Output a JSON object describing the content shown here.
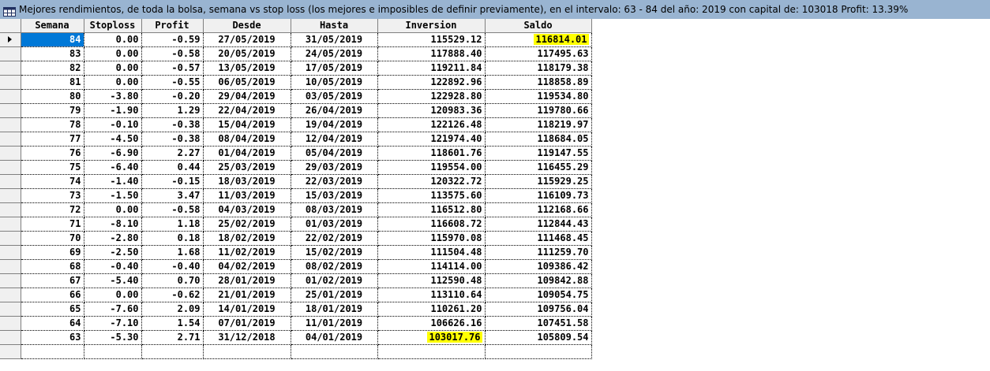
{
  "window": {
    "title": "Mejores rendimientos, de toda la bolsa, semana vs stop loss (los mejores e imposibles de definir previamente), en el intervalo: 63 - 84 del año: 2019 con capital de: 103018 Profit: 13.39%"
  },
  "table": {
    "columns": [
      "Semana",
      "Stoploss",
      "Profit",
      "Desde",
      "Hasta",
      "Inversion",
      "Saldo"
    ],
    "rows": [
      [
        "84",
        "0.00",
        "-0.59",
        "27/05/2019",
        "31/05/2019",
        "115529.12",
        "116814.01"
      ],
      [
        "83",
        "0.00",
        "-0.58",
        "20/05/2019",
        "24/05/2019",
        "117888.40",
        "117495.63"
      ],
      [
        "82",
        "0.00",
        "-0.57",
        "13/05/2019",
        "17/05/2019",
        "119211.84",
        "118179.38"
      ],
      [
        "81",
        "0.00",
        "-0.55",
        "06/05/2019",
        "10/05/2019",
        "122892.96",
        "118858.89"
      ],
      [
        "80",
        "-3.80",
        "-0.20",
        "29/04/2019",
        "03/05/2019",
        "122928.80",
        "119534.80"
      ],
      [
        "79",
        "-1.90",
        "1.29",
        "22/04/2019",
        "26/04/2019",
        "120983.36",
        "119780.66"
      ],
      [
        "78",
        "-0.10",
        "-0.38",
        "15/04/2019",
        "19/04/2019",
        "122126.48",
        "118219.97"
      ],
      [
        "77",
        "-4.50",
        "-0.38",
        "08/04/2019",
        "12/04/2019",
        "121974.40",
        "118684.05"
      ],
      [
        "76",
        "-6.90",
        "2.27",
        "01/04/2019",
        "05/04/2019",
        "118601.76",
        "119147.55"
      ],
      [
        "75",
        "-6.40",
        "0.44",
        "25/03/2019",
        "29/03/2019",
        "119554.00",
        "116455.29"
      ],
      [
        "74",
        "-1.40",
        "-0.15",
        "18/03/2019",
        "22/03/2019",
        "120322.72",
        "115929.25"
      ],
      [
        "73",
        "-1.50",
        "3.47",
        "11/03/2019",
        "15/03/2019",
        "113575.60",
        "116109.73"
      ],
      [
        "72",
        "0.00",
        "-0.58",
        "04/03/2019",
        "08/03/2019",
        "116512.80",
        "112168.66"
      ],
      [
        "71",
        "-8.10",
        "1.18",
        "25/02/2019",
        "01/03/2019",
        "116608.72",
        "112844.43"
      ],
      [
        "70",
        "-2.80",
        "0.18",
        "18/02/2019",
        "22/02/2019",
        "115970.08",
        "111468.45"
      ],
      [
        "69",
        "-2.50",
        "1.68",
        "11/02/2019",
        "15/02/2019",
        "111504.48",
        "111259.70"
      ],
      [
        "68",
        "-0.40",
        "-0.40",
        "04/02/2019",
        "08/02/2019",
        "114114.00",
        "109386.42"
      ],
      [
        "67",
        "-5.40",
        "0.70",
        "28/01/2019",
        "01/02/2019",
        "112590.48",
        "109842.88"
      ],
      [
        "66",
        "0.00",
        "-0.62",
        "21/01/2019",
        "25/01/2019",
        "113110.64",
        "109054.75"
      ],
      [
        "65",
        "-7.60",
        "2.09",
        "14/01/2019",
        "18/01/2019",
        "110261.20",
        "109756.04"
      ],
      [
        "64",
        "-7.10",
        "1.54",
        "07/01/2019",
        "11/01/2019",
        "106626.16",
        "107451.58"
      ],
      [
        "63",
        "-5.30",
        "2.71",
        "31/12/2018",
        "04/01/2019",
        "103017.76",
        "105809.54"
      ]
    ],
    "selected_row": 0,
    "highlights": [
      {
        "row": 0,
        "col": 6,
        "color": "#ffff00"
      },
      {
        "row": 21,
        "col": 5,
        "color": "#ffff00"
      }
    ]
  },
  "colors": {
    "titlebar": "#99b4d1",
    "selection": "#0078d7",
    "highlight": "#ffff00"
  },
  "icons": {
    "app": "grid-app-icon",
    "row_indicator": "row-pointer-icon"
  }
}
